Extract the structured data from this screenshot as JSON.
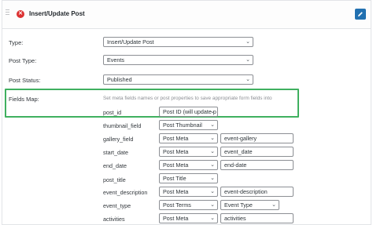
{
  "header": {
    "title": "Insert/Update Post",
    "accent": "#2271b1",
    "close_color": "#dc3232"
  },
  "form": {
    "type_label": "Type:",
    "type_value": "Insert/Update Post",
    "post_type_label": "Post Type:",
    "post_type_value": "Events",
    "post_status_label": "Post Status:",
    "post_status_value": "Published",
    "fields_map_label": "Fields Map:",
    "fields_map_hint": "Set meta fields names or post properties to save appropriate form fields into"
  },
  "fields": [
    {
      "name": "post_id",
      "type": "Post ID (will update p",
      "value": ""
    },
    {
      "name": "thumbnail_field",
      "type": "Post Thumbnail",
      "value": ""
    },
    {
      "name": "gallery_field",
      "type": "Post Meta",
      "value": "event-gallery"
    },
    {
      "name": "start_date",
      "type": "Post Meta",
      "value": "event_date"
    },
    {
      "name": "end_date",
      "type": "Post Meta",
      "value": "end-date"
    },
    {
      "name": "post_title",
      "type": "Post Title",
      "value": ""
    },
    {
      "name": "event_description",
      "type": "Post Meta",
      "value": "event-description"
    },
    {
      "name": "event_type",
      "type": "Post Terms",
      "value": "Event Type"
    },
    {
      "name": "activities",
      "type": "Post Meta",
      "value": "activities"
    }
  ],
  "highlight_color": "#3fb05f"
}
